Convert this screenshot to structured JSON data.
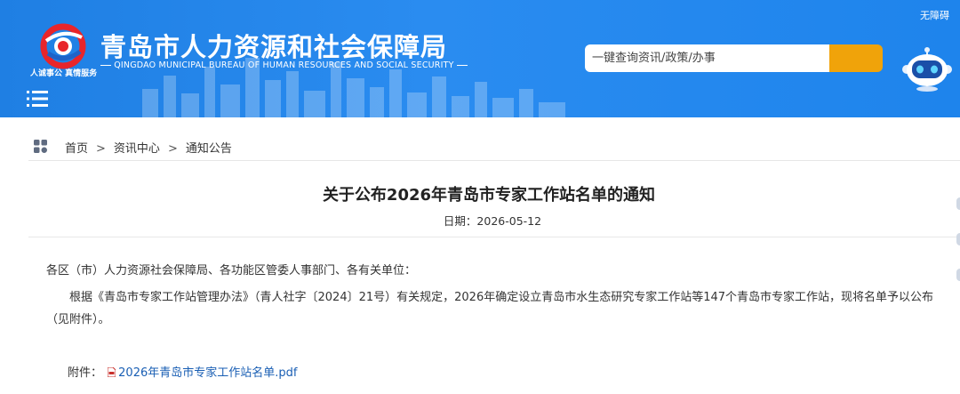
{
  "header": {
    "site_title": "青岛市人力资源和社会保障局",
    "site_subtitle": "QINGDAO MUNICIPAL BUREAU OF HUMAN RESOURCES AND SOCIAL SECURITY",
    "logo_caption": "人诚事公 真情服务",
    "accessibility_label": "无障碍",
    "search_placeholder": "一键查询资讯/政策/办事",
    "brand_color": "#2a8cf0",
    "search_button_color": "#f0a30a"
  },
  "breadcrumb": {
    "items": [
      "首页",
      "资讯中心",
      "通知公告"
    ],
    "separator": ">"
  },
  "article": {
    "title": "关于公布2026年青岛市专家工作站名单的通知",
    "date": "日期：2026-05-12",
    "salutation": "各区（市）人力资源社会保障局、各功能区管委人事部门、各有关单位：",
    "body": "根据《青岛市专家工作站管理办法》（青人社字〔2024〕21号）有关规定，2026年确定设立青岛市水生态研究专家工作站等147个青岛市专家工作站，现将名单予以公布（见附件）。",
    "attachment_label": "附件：",
    "attachment_link": "2026年青岛市专家工作站名单.pdf"
  },
  "icons": [
    "logo-icon",
    "menu-icon",
    "search-icon",
    "robot-assistant-icon",
    "grid-home-icon",
    "pdf-icon"
  ]
}
